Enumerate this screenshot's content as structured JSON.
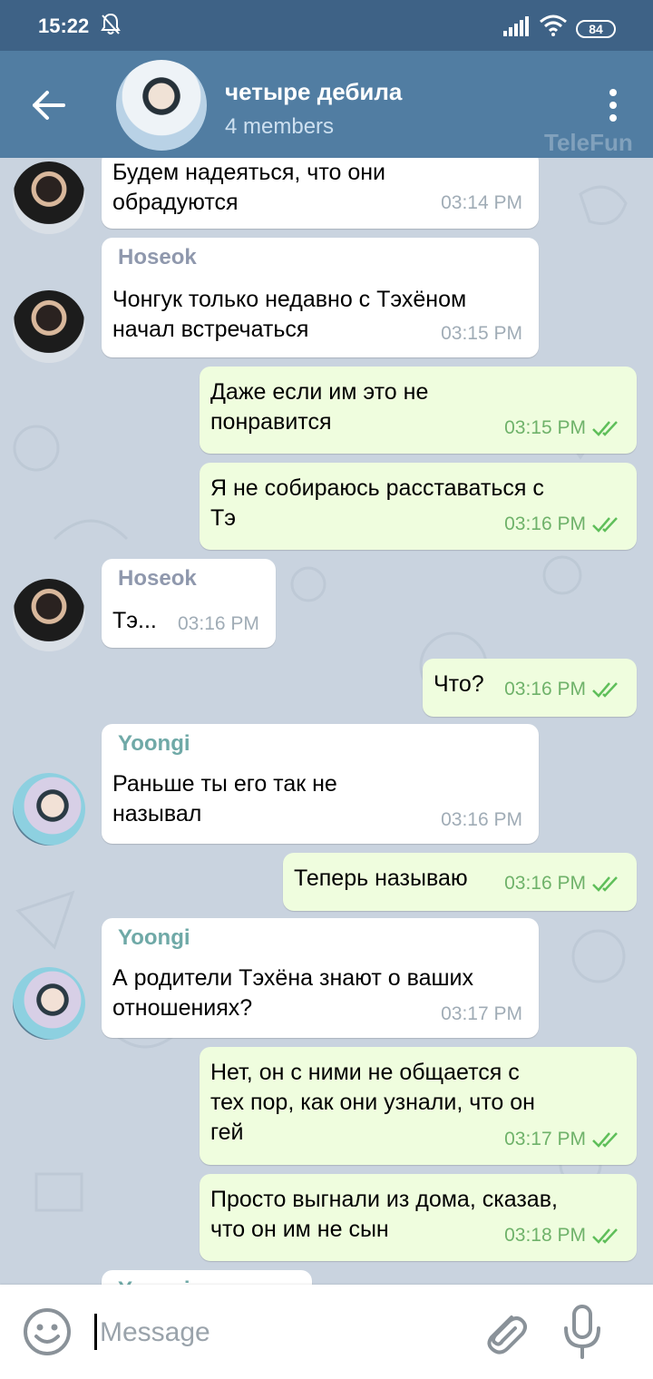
{
  "status_bar": {
    "time": "15:22",
    "battery": "84"
  },
  "header": {
    "title": "четыре дебила",
    "members": "4 members",
    "watermark": "TeleFun"
  },
  "messages": [
    {
      "dir": "in",
      "sender": "",
      "text": "Будем надеяться, что они обрадуются",
      "time": "03:14 PM"
    },
    {
      "dir": "in",
      "sender": "Hoseok",
      "text": "Чонгук только недавно с Тэхёном начал встречаться",
      "time": "03:15 PM"
    },
    {
      "dir": "out",
      "text": "Даже если им это не понравится",
      "time": "03:15 PM"
    },
    {
      "dir": "out",
      "text": "Я не собираюсь расставаться с Тэ",
      "time": "03:16 PM"
    },
    {
      "dir": "in",
      "sender": "Hoseok",
      "text": "Тэ...",
      "time": "03:16 PM"
    },
    {
      "dir": "out",
      "text": "Что?",
      "time": "03:16 PM"
    },
    {
      "dir": "in",
      "sender": "Yoongi",
      "text": "Раньше ты его так не называл",
      "time": "03:16 PM"
    },
    {
      "dir": "out",
      "text": "Теперь называю",
      "time": "03:16 PM"
    },
    {
      "dir": "in",
      "sender": "Yoongi",
      "text": "А родители Тэхёна знают о ваших отношениях?",
      "time": "03:17 PM"
    },
    {
      "dir": "out",
      "text": "Нет, он с ними не общается с тех пор, как они узнали, что он гей",
      "time": "03:17 PM"
    },
    {
      "dir": "out",
      "text": "Просто выгнали из дома, сказав, что он им не сын",
      "time": "03:18 PM"
    },
    {
      "dir": "in",
      "sender": "Yoongi",
      "text": "",
      "time": ""
    }
  ],
  "message_lines": {
    "m0": [
      "Будем надеяться, что они",
      "обрадуются"
    ],
    "m1": [
      "Чонгук только недавно с Тэхёном",
      "начал встречаться"
    ],
    "m2": [
      "Даже если им это не",
      "понравится"
    ],
    "m3": [
      "Я не собираюсь расставаться с",
      "Тэ"
    ],
    "m6": [
      "Раньше ты его так не",
      "называл"
    ],
    "m8": [
      "А родители Тэхёна знают о ваших",
      "отношениях?"
    ],
    "m9": [
      "Нет, он с ними не общается с",
      "тех пор, как они узнали, что он",
      "гей"
    ],
    "m10": [
      "Просто выгнали из дома, сказав,",
      "что он им не сын"
    ]
  },
  "input": {
    "placeholder": "Message",
    "value": ""
  },
  "colors": {
    "status_bar": "#3e6286",
    "header": "#517da2",
    "chat_bg": "#c9d3df",
    "incoming_bubble": "#ffffff",
    "outgoing_bubble": "#effdde",
    "hoseok_name": "#8f98ad",
    "yoongi_name": "#6fa9a7",
    "out_time": "#6fb26a"
  },
  "icons": [
    "back-arrow-icon",
    "more-vert-icon",
    "mute-bell-icon",
    "signal-icon",
    "wifi-icon",
    "double-check-icon",
    "emoji-icon",
    "paperclip-icon",
    "microphone-icon"
  ]
}
